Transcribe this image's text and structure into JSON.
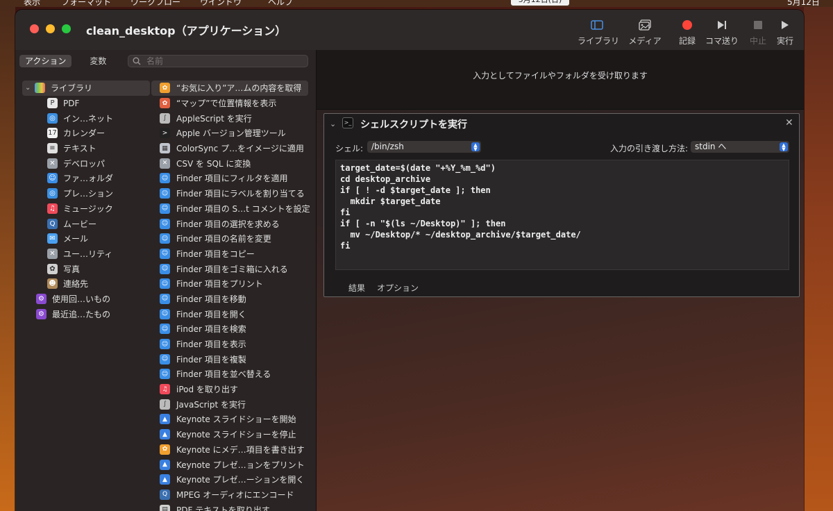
{
  "menubar": {
    "items": [
      "表示",
      "フォーマット",
      "ワークフロー",
      "ウインドウ",
      "ヘルプ"
    ],
    "date": "5月12日(日)",
    "clock": "5月12日"
  },
  "window": {
    "title": "clean_desktop（アプリケーション）",
    "toolbar": {
      "library": "ライブラリ",
      "media": "メディア",
      "record": "記録",
      "step": "コマ送り",
      "stop": "中止",
      "run": "実行"
    }
  },
  "left": {
    "tabs": [
      "アクション",
      "変数"
    ],
    "search_placeholder": "名前",
    "library": {
      "root": "ライブラリ",
      "children": [
        {
          "label": "PDF",
          "icon": "pdf-icon",
          "color": "#e8e8e8"
        },
        {
          "label": "イン…ネット",
          "icon": "safari-icon",
          "color": "#3b8fe0"
        },
        {
          "label": "カレンダー",
          "icon": "calendar-icon",
          "color": "#f2f2f2"
        },
        {
          "label": "テキスト",
          "icon": "text-icon",
          "color": "#e0e0e0"
        },
        {
          "label": "デベロッパ",
          "icon": "tools-icon",
          "color": "#9aa0a8"
        },
        {
          "label": "ファ…ォルダ",
          "icon": "finder-icon",
          "color": "#3a8ee6"
        },
        {
          "label": "プレ…ション",
          "icon": "globe-icon",
          "color": "#3b8fe0"
        },
        {
          "label": "ミュージック",
          "icon": "music-icon",
          "color": "#f04a5a"
        },
        {
          "label": "ムービー",
          "icon": "quicktime-icon",
          "color": "#3a6fb0"
        },
        {
          "label": "メール",
          "icon": "mail-icon",
          "color": "#4aa0f0"
        },
        {
          "label": "ユー…リティ",
          "icon": "utility-icon",
          "color": "#9aa0a8"
        },
        {
          "label": "写真",
          "icon": "photos-icon",
          "color": "#d0d0d0"
        },
        {
          "label": "連絡先",
          "icon": "contacts-icon",
          "color": "#b08a5a"
        }
      ],
      "smart_groups": [
        {
          "label": "使用回…いもの",
          "icon": "smart-folder-icon",
          "color": "#8a4ad0"
        },
        {
          "label": "最近追…たもの",
          "icon": "smart-folder-icon",
          "color": "#8a4ad0"
        }
      ]
    },
    "actions": [
      {
        "label": "“お気に入り”ア…ムの内容を取得",
        "icon": "photos-icon",
        "color": "#f0a030",
        "selected": true
      },
      {
        "label": "“マップ”で位置情報を表示",
        "icon": "maps-icon",
        "color": "#e06040"
      },
      {
        "label": "AppleScript を実行",
        "icon": "script-icon",
        "color": "#bbbbbb"
      },
      {
        "label": "Apple バージョン管理ツール",
        "icon": "terminal-icon",
        "color": "#222222"
      },
      {
        "label": "ColorSync プ…をイメージに適用",
        "icon": "colorsync-icon",
        "color": "#c0c4cc"
      },
      {
        "label": "CSV を SQL に変換",
        "icon": "tools-icon",
        "color": "#9aa0a8"
      },
      {
        "label": "Finder 項目にフィルタを適用",
        "icon": "finder-icon",
        "color": "#3a8ee6"
      },
      {
        "label": "Finder 項目にラベルを割り当てる",
        "icon": "finder-icon",
        "color": "#3a8ee6"
      },
      {
        "label": "Finder 項目の S…t コメントを設定",
        "icon": "finder-icon",
        "color": "#3a8ee6"
      },
      {
        "label": "Finder 項目の選択を求める",
        "icon": "finder-icon",
        "color": "#3a8ee6"
      },
      {
        "label": "Finder 項目の名前を変更",
        "icon": "finder-icon",
        "color": "#3a8ee6"
      },
      {
        "label": "Finder 項目をコピー",
        "icon": "finder-icon",
        "color": "#3a8ee6"
      },
      {
        "label": "Finder 項目をゴミ箱に入れる",
        "icon": "finder-icon",
        "color": "#3a8ee6"
      },
      {
        "label": "Finder 項目をプリント",
        "icon": "finder-icon",
        "color": "#3a8ee6"
      },
      {
        "label": "Finder 項目を移動",
        "icon": "finder-icon",
        "color": "#3a8ee6"
      },
      {
        "label": "Finder 項目を開く",
        "icon": "finder-icon",
        "color": "#3a8ee6"
      },
      {
        "label": "Finder 項目を検索",
        "icon": "finder-icon",
        "color": "#3a8ee6"
      },
      {
        "label": "Finder 項目を表示",
        "icon": "finder-icon",
        "color": "#3a8ee6"
      },
      {
        "label": "Finder 項目を複製",
        "icon": "finder-icon",
        "color": "#3a8ee6"
      },
      {
        "label": "Finder 項目を並べ替える",
        "icon": "finder-icon",
        "color": "#3a8ee6"
      },
      {
        "label": "iPod を取り出す",
        "icon": "music-icon",
        "color": "#f04a5a"
      },
      {
        "label": "JavaScript を実行",
        "icon": "script-icon",
        "color": "#bbbbbb"
      },
      {
        "label": "Keynote スライドショーを開始",
        "icon": "keynote-icon",
        "color": "#3a80e0"
      },
      {
        "label": "Keynote スライドショーを停止",
        "icon": "keynote-icon",
        "color": "#3a80e0"
      },
      {
        "label": "Keynote にメデ…項目を書き出す",
        "icon": "photos-icon",
        "color": "#f0a030"
      },
      {
        "label": "Keynote プレゼ…ョンをプリント",
        "icon": "keynote-icon",
        "color": "#3a80e0"
      },
      {
        "label": "Keynote プレゼ…ーションを開く",
        "icon": "keynote-icon",
        "color": "#3a80e0"
      },
      {
        "label": "MPEG オーディオにエンコード",
        "icon": "quicktime-icon",
        "color": "#3a6fb0"
      },
      {
        "label": "PDF テキストを取り出す",
        "icon": "preview-icon",
        "color": "#d0d0d0"
      }
    ]
  },
  "workflow": {
    "hint": "入力としてファイルやフォルダを受け取ります",
    "action": {
      "title": "シェルスクリプトを実行",
      "shell_label": "シェル:",
      "shell_value": "/bin/zsh",
      "pass_label": "入力の引き渡し方法:",
      "pass_value": "stdin へ",
      "code": "target_date=$(date \"+%Y_%m_%d\")\ncd desktop_archive\nif [ ! -d $target_date ]; then\n  mkdir $target_date\nfi\nif [ -n \"$(ls ~/Desktop)\" ]; then\n  mv ~/Desktop/* ~/desktop_archive/$target_date/\nfi",
      "tabs": [
        "結果",
        "オプション"
      ]
    }
  },
  "colors": {
    "accent": "#2f6fd6",
    "record": "#ff453a",
    "toolbar_active": "#4a90e2"
  }
}
